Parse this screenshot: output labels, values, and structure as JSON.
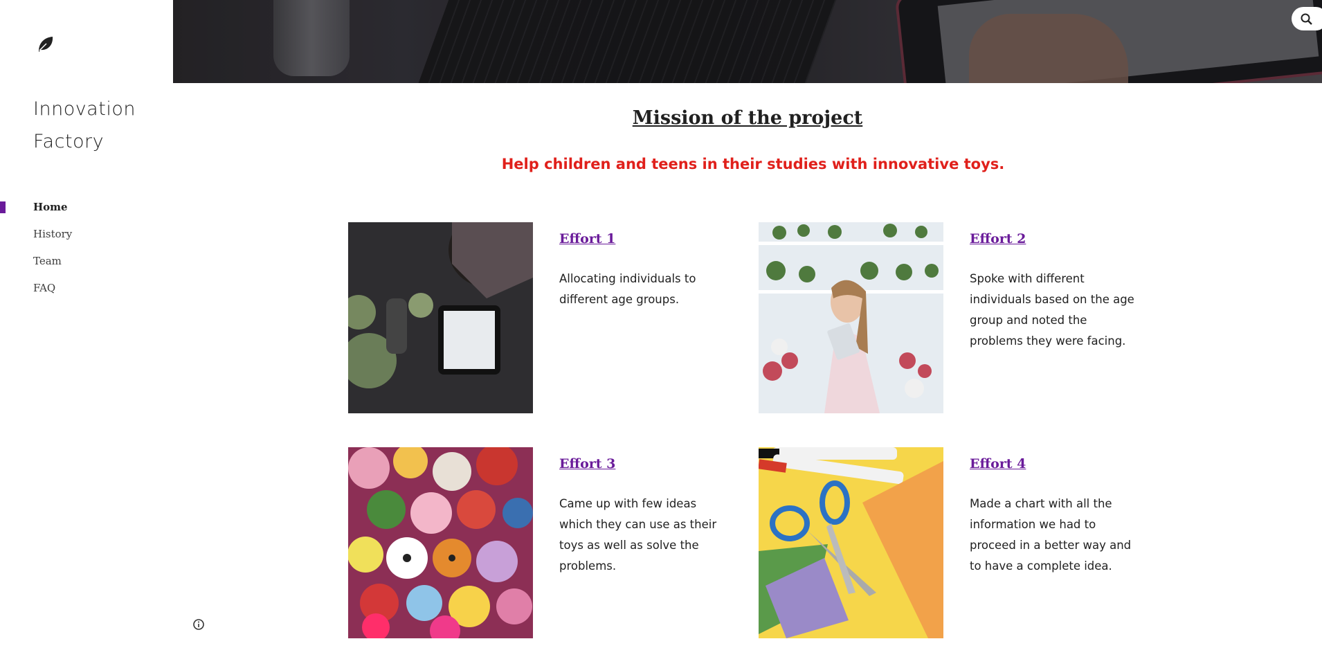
{
  "site": {
    "title": "Innovation Factory",
    "logo_icon": "leaf-icon"
  },
  "nav": {
    "items": [
      {
        "label": "Home",
        "active": true
      },
      {
        "label": "History",
        "active": false
      },
      {
        "label": "Team",
        "active": false
      },
      {
        "label": "FAQ",
        "active": false
      }
    ]
  },
  "header": {
    "search_icon": "search-icon"
  },
  "main": {
    "heading": "Mission of the project",
    "tagline": "Help children and teens in their studies with innovative toys.",
    "cards": [
      {
        "title": "Effort 1",
        "text": "Allocating individuals to different age groups.",
        "image": "person-with-tablet-and-plants-photo"
      },
      {
        "title": "Effort 2",
        "text": "Spoke with different individuals based on the age group and noted the problems they were facing.",
        "image": "florist-with-tablet-photo"
      },
      {
        "title": "Effort 3",
        "text": "Came up with few ideas which they can use as their toys as well as solve the problems.",
        "image": "pile-of-plush-toys-photo"
      },
      {
        "title": "Effort 4",
        "text": "Made a chart with all the information we had to proceed in a better way and to have a complete idea.",
        "image": "crayons-scissors-paper-photo"
      }
    ]
  },
  "footer": {
    "info_icon": "info-icon"
  },
  "colors": {
    "accent": "#6a1b9a",
    "tagline": "#e0201b"
  }
}
